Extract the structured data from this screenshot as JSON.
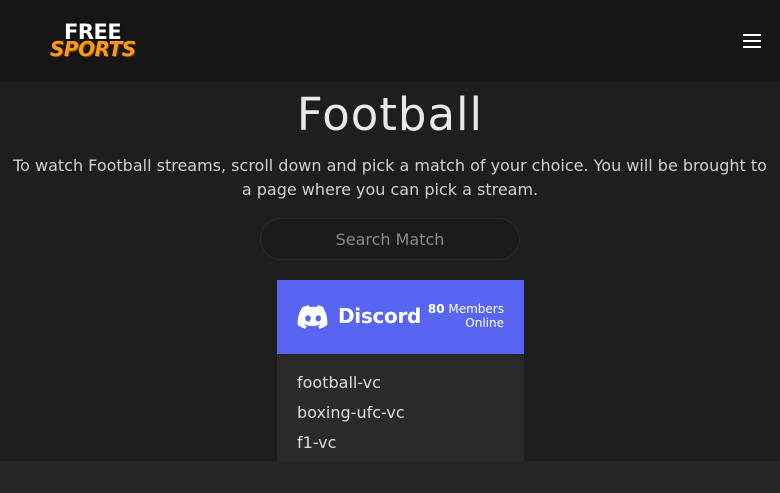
{
  "header": {
    "logo_line1": "FREE",
    "logo_line2": "SPORTS",
    "menu_icon": "hamburger-icon"
  },
  "main": {
    "title": "Football",
    "intro": "To watch Football streams, scroll down and pick a match of your choice. You will be brought to a page where you can pick a stream.",
    "search_placeholder": "Search Match"
  },
  "discord": {
    "brand": "Discord",
    "member_count": "80",
    "members_label": "Members",
    "online_label": "Online",
    "channels": [
      "football-vc",
      "boxing-ufc-vc",
      "f1-vc"
    ],
    "accent_color": "#5865f2"
  },
  "colors": {
    "background": "#1e1e1e",
    "navbar": "#161616",
    "logo_accent": "#ff9a1a"
  }
}
